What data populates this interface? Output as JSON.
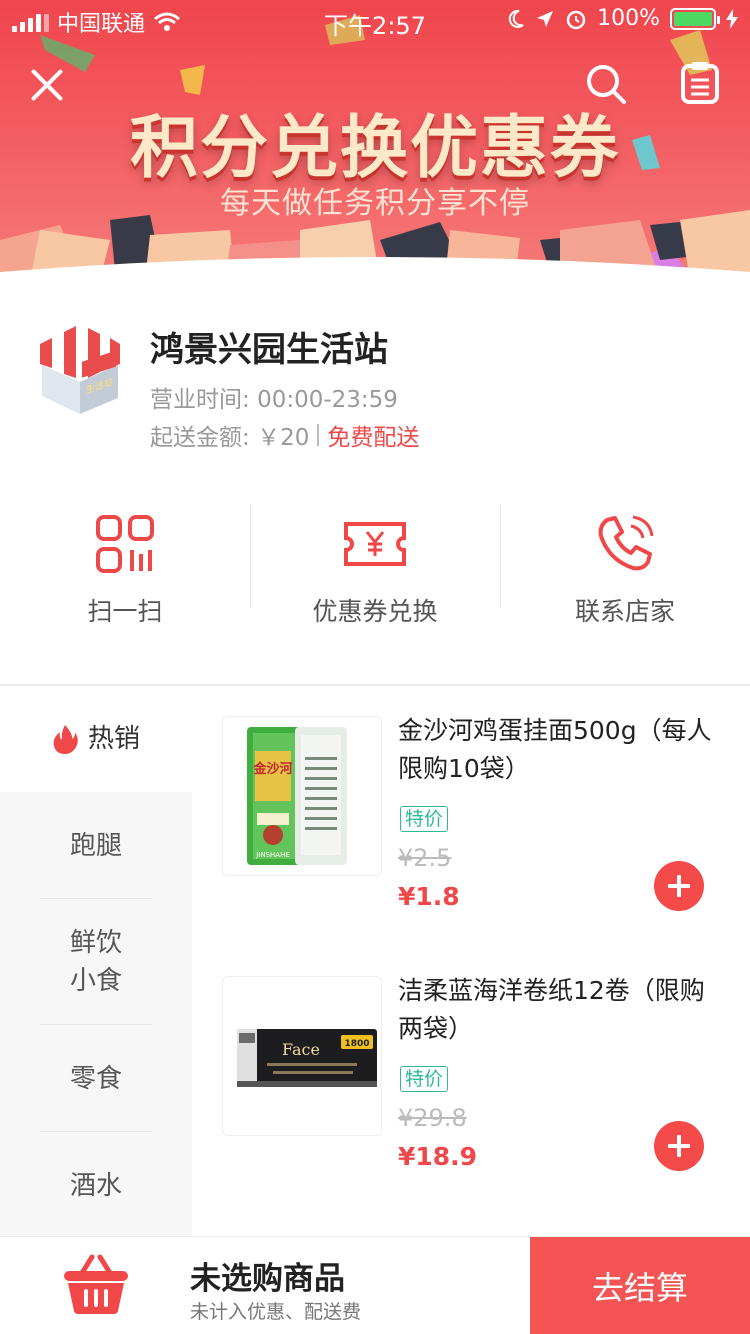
{
  "status_bar": {
    "carrier": "中国联通",
    "time": "下午2:57",
    "battery": "100%"
  },
  "banner": {
    "title": "积分兑换优惠券",
    "subtitle": "每天做任务积分享不停"
  },
  "shop": {
    "name": "鸿景兴园生活站",
    "hours_label": "营业时间:",
    "hours_value": "00:00-23:59",
    "min_label": "起送金额:",
    "min_value": "￥20",
    "free_delivery": "免费配送",
    "icon_sign": "生活站"
  },
  "actions": [
    {
      "label": "扫一扫",
      "icon": "scan-icon"
    },
    {
      "label": "优惠券兑换",
      "icon": "coupon-icon"
    },
    {
      "label": "联系店家",
      "icon": "phone-icon"
    }
  ],
  "categories": [
    {
      "label": "热销",
      "active": true,
      "icon": "fire-icon"
    },
    {
      "label": "跑腿"
    },
    {
      "label": "鲜饮\n小食"
    },
    {
      "label": "零食"
    },
    {
      "label": "酒水"
    }
  ],
  "products": [
    {
      "title": "金沙河鸡蛋挂面500g（每人限购10袋）",
      "tag": "特价",
      "old_price": "¥2.5",
      "price": "¥1.8",
      "package_text": "金沙河",
      "package_subtext": "JINSHAHE"
    },
    {
      "title": "洁柔蓝海洋卷纸12卷（限购两袋）",
      "tag": "特价",
      "old_price": "¥29.8",
      "price": "¥18.9",
      "package_text": "Face",
      "package_badge": "1800"
    }
  ],
  "cart": {
    "title": "未选购商品",
    "subtitle": "未计入优惠、配送费",
    "checkout": "去结算"
  },
  "colors": {
    "accent": "#f44a4a",
    "banner": "#f0454d",
    "tag": "#2fb89a"
  }
}
